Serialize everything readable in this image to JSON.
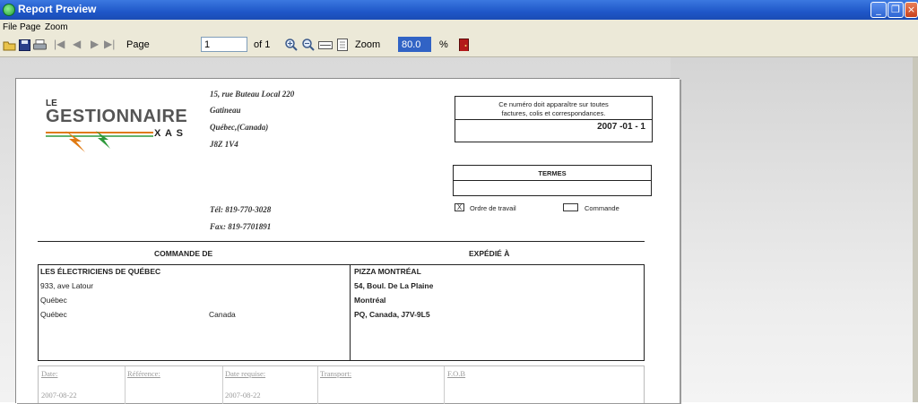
{
  "window": {
    "title": "Report Preview"
  },
  "menu": {
    "file": "File",
    "page": "Page",
    "zoom": "Zoom"
  },
  "toolbar": {
    "page_label": "Page",
    "page_value": "1",
    "of_label": "of 1",
    "zoom_label": "Zoom",
    "zoom_value": "80.0",
    "percent": "%"
  },
  "colors": {
    "titlebar": "#2458c6",
    "accent_red": "#b41a1a",
    "logo_orange": "#e07a12",
    "logo_green": "#2f9a3b"
  },
  "report": {
    "logo": {
      "le": "LE",
      "main": "GESTIONNAIRE",
      "sub": "X A S"
    },
    "address": {
      "line1": "15, rue Buteau Local 220",
      "line2": "Gatineau",
      "line3": "Québec,(Canada)",
      "line4": "J8Z 1V4",
      "tel": "Tél: 819-770-3028",
      "fax": "Fax: 819-7701891"
    },
    "notice": {
      "line1": "Ce numéro doit apparaître sur toutes",
      "line2": "factures, colis et correspondances.",
      "number": "2007 -01 - 1"
    },
    "terms": {
      "title": "TERMES",
      "option1": "Ordre de travail",
      "option1_mark": "X",
      "option2": "Commande"
    },
    "order_from": {
      "header": "COMMANDE DE",
      "name": "LES ÉLECTRICIENS DE QUÉBEC",
      "street": "933, ave Latour",
      "city": "Québec",
      "province": "Québec",
      "country": "Canada"
    },
    "ship_to": {
      "header": "EXPÉDIÉ À",
      "name": "PIZZA MONTRÉAL",
      "street": "54, Boul. De La Plaine",
      "city": "Montréal",
      "region": "PQ, Canada, J7V-9L5"
    },
    "info_row": {
      "headers": [
        "Date:",
        "Référence:",
        "Date requise:",
        "Transport:",
        "F.O.B"
      ],
      "values": [
        "2007-08-22",
        "",
        "2007-08-22",
        "",
        ""
      ]
    }
  }
}
